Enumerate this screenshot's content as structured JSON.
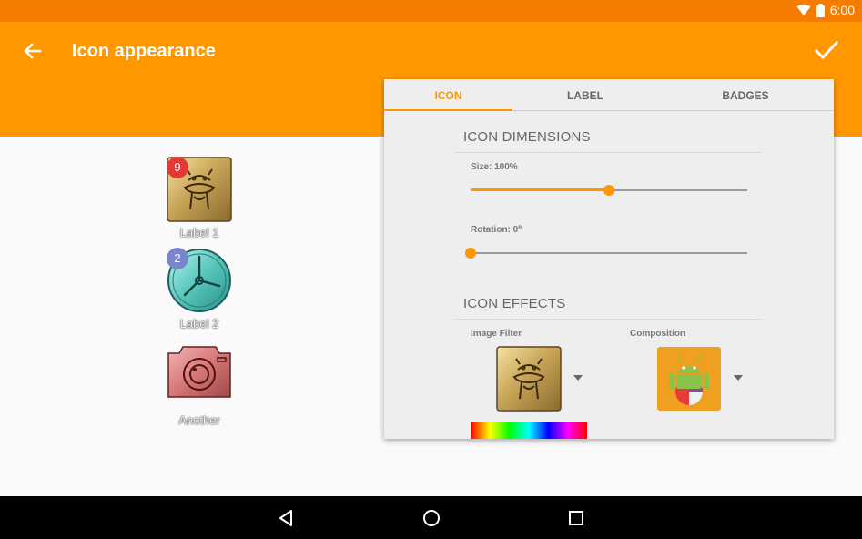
{
  "status_bar": {
    "time": "6:00",
    "icons": [
      "wifi-icon",
      "battery-icon"
    ]
  },
  "app_bar": {
    "title": "Icon appearance",
    "back_icon": "arrow-left-icon",
    "confirm_icon": "check-icon",
    "color": "#ff9800",
    "status_color": "#f57c00"
  },
  "preview": {
    "items": [
      {
        "label": "Label 1",
        "badge": "9",
        "badge_color": "#e53935",
        "icon": "gold-android-icon"
      },
      {
        "label": "Label 2",
        "badge": "2",
        "badge_color": "#7986cb",
        "icon": "teal-clock-icon"
      },
      {
        "label": "Another",
        "badge": "",
        "icon": "red-camera-icon"
      }
    ]
  },
  "tabs": [
    {
      "label": "ICON",
      "active": true
    },
    {
      "label": "LABEL",
      "active": false
    },
    {
      "label": "BADGES",
      "active": false
    }
  ],
  "icon_dimensions": {
    "title": "ICON DIMENSIONS",
    "size_label": "Size: 100%",
    "size_value": 0.5,
    "rotation_label": "Rotation: 0º",
    "rotation_value": 0
  },
  "icon_effects": {
    "title": "ICON EFFECTS",
    "image_filter_label": "Image Filter",
    "composition_label": "Composition"
  },
  "accent_color": "#ff9800",
  "nav_bar": {
    "buttons": [
      "back-triangle-icon",
      "home-circle-icon",
      "recents-square-icon"
    ]
  }
}
